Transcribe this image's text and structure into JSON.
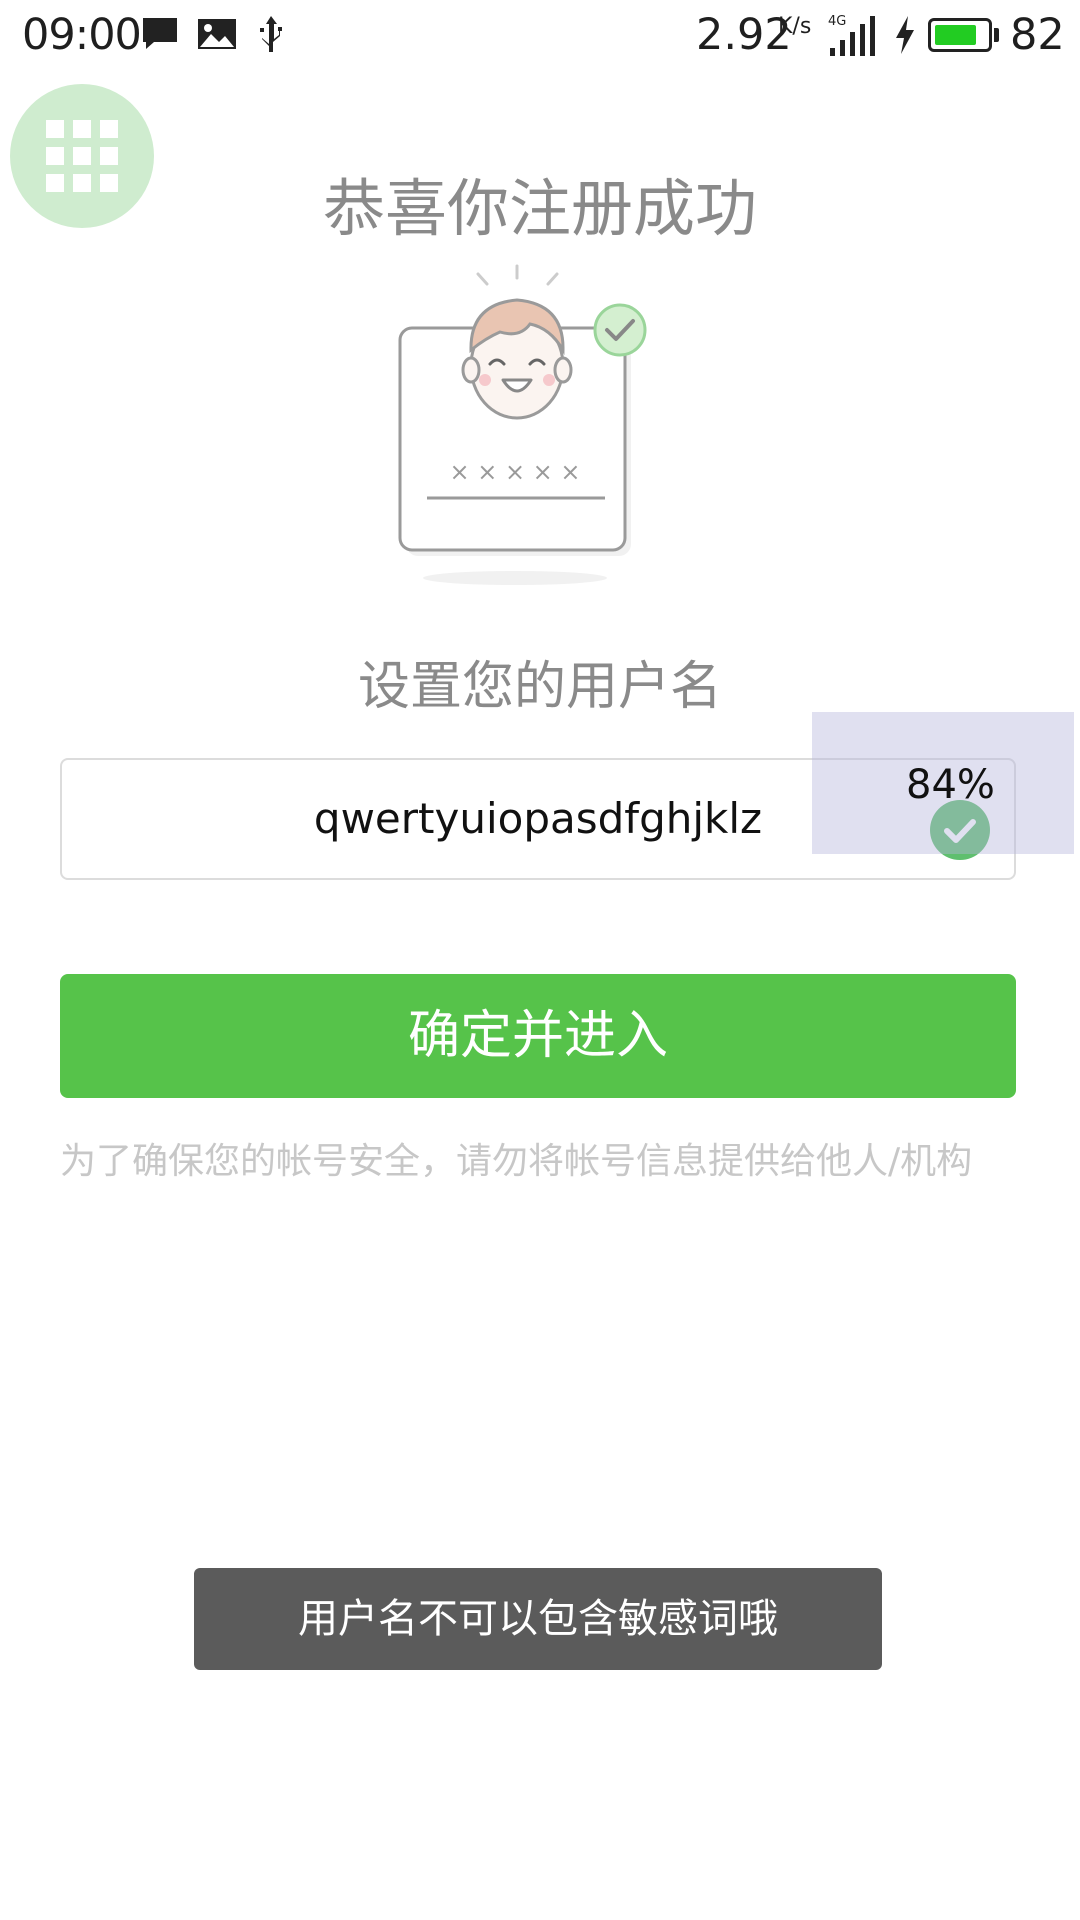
{
  "status_bar": {
    "time": "09:00",
    "speed": "2.92",
    "speed_unit": "K/s",
    "network": "4G",
    "battery_level": "82",
    "battery_fill": 0.82,
    "icons": [
      "message-icon",
      "image-icon",
      "usb-icon",
      "signal-icon",
      "charging-icon",
      "battery-icon"
    ]
  },
  "floating_menu": {
    "icon": "grid-icon",
    "color": "#cfeccf"
  },
  "page": {
    "title": "恭喜你注册成功",
    "illustration_mask": "× × × × ×",
    "subtitle": "设置您的用户名"
  },
  "username": {
    "value": "qwertyuiopasdfghjklz",
    "valid_icon": "check-circle-icon"
  },
  "overlay": {
    "percent": "84%"
  },
  "confirm_button": {
    "label": "确定并进入",
    "color": "#56c34a"
  },
  "notice": "为了确保您的帐号安全，请勿将帐号信息提供给他人/机构",
  "toast": "用户名不可以包含敏感词哦"
}
